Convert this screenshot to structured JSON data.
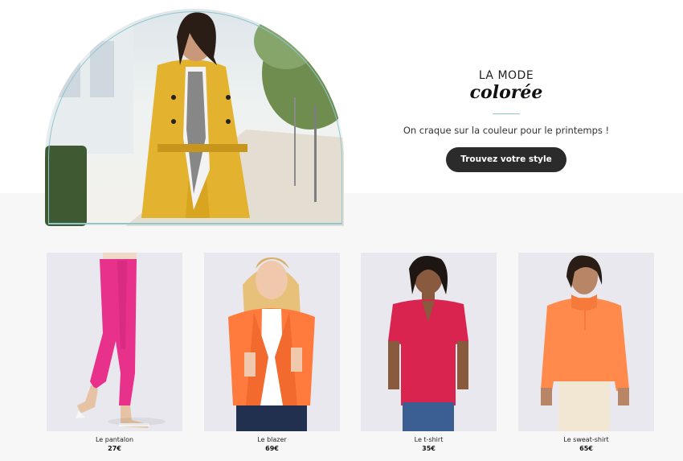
{
  "hero": {
    "kicker": "LA MODE",
    "title": "colorée",
    "subtitle": "On craque sur la couleur pour le printemps !",
    "cta_label": "Trouvez votre style",
    "accent_color": "#8fc7cf",
    "image_subject": "woman-yellow-trench-coat"
  },
  "products": [
    {
      "name": "Le pantalon",
      "price": "27€",
      "color": "#e8318a",
      "image_subject": "pink-trousers"
    },
    {
      "name": "Le blazer",
      "price": "69€",
      "color": "#ff7a3d",
      "image_subject": "orange-blazer"
    },
    {
      "name": "Le t-shirt",
      "price": "35€",
      "color": "#d8244f",
      "image_subject": "red-tshirt"
    },
    {
      "name": "Le sweat-shirt",
      "price": "65€",
      "color": "#ff8a4c",
      "image_subject": "orange-sweatshirt"
    }
  ]
}
